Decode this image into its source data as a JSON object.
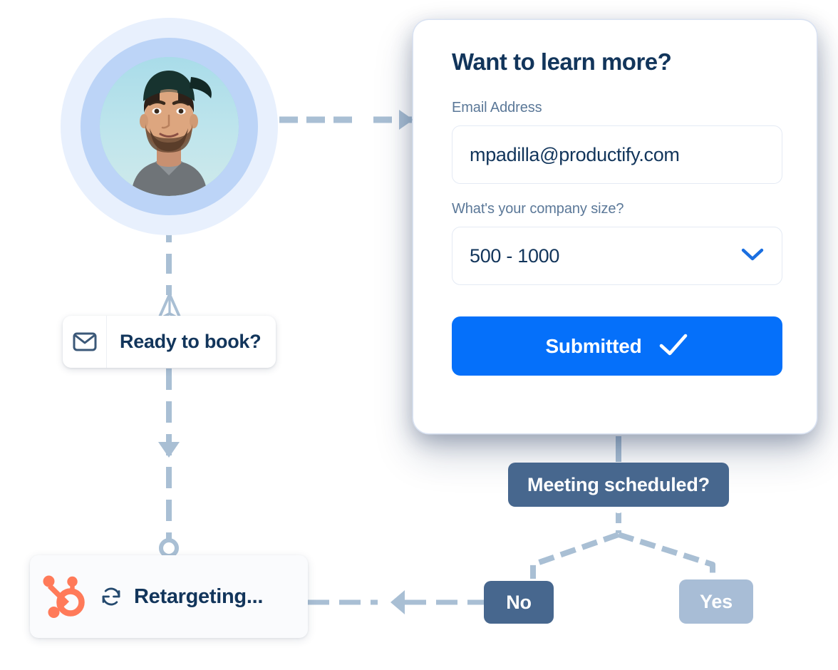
{
  "avatar": {
    "name": "contact-avatar",
    "alt": "Photo of a smiling man wearing a backwards cap"
  },
  "flow_nodes": {
    "ready_to_book": {
      "icon": "envelope-icon",
      "label": "Ready to book?"
    },
    "send_marker": {
      "icon": "paper-plane-icon"
    },
    "retargeting": {
      "brand_icon": "hubspot-logo-icon",
      "status_icon": "sync-refresh-icon",
      "label": "Retargeting..."
    }
  },
  "form_card": {
    "title": "Want to learn more?",
    "email_field": {
      "label": "Email Address",
      "value": "mpadilla@productify.com",
      "placeholder": "Email Address"
    },
    "company_size_field": {
      "label": "What's your company size?",
      "value": "500 - 1000",
      "chevron_icon": "chevron-down-icon"
    },
    "submit": {
      "label": "Submitted",
      "icon": "check-icon"
    }
  },
  "decision": {
    "question": "Meeting scheduled?",
    "branch_no": "No",
    "branch_yes": "Yes"
  },
  "colors": {
    "accent_blue": "#0570FA",
    "brand_orange": "#FF7A59",
    "slate_dark": "#47678E",
    "slate_light": "#A8BDD6",
    "navy_text": "#12355B",
    "muted_text": "#5B7898",
    "wire": "#A9BFD4",
    "avatar_ring_outer": "#E8F0FD",
    "avatar_ring_inner": "#BCD4F7"
  }
}
